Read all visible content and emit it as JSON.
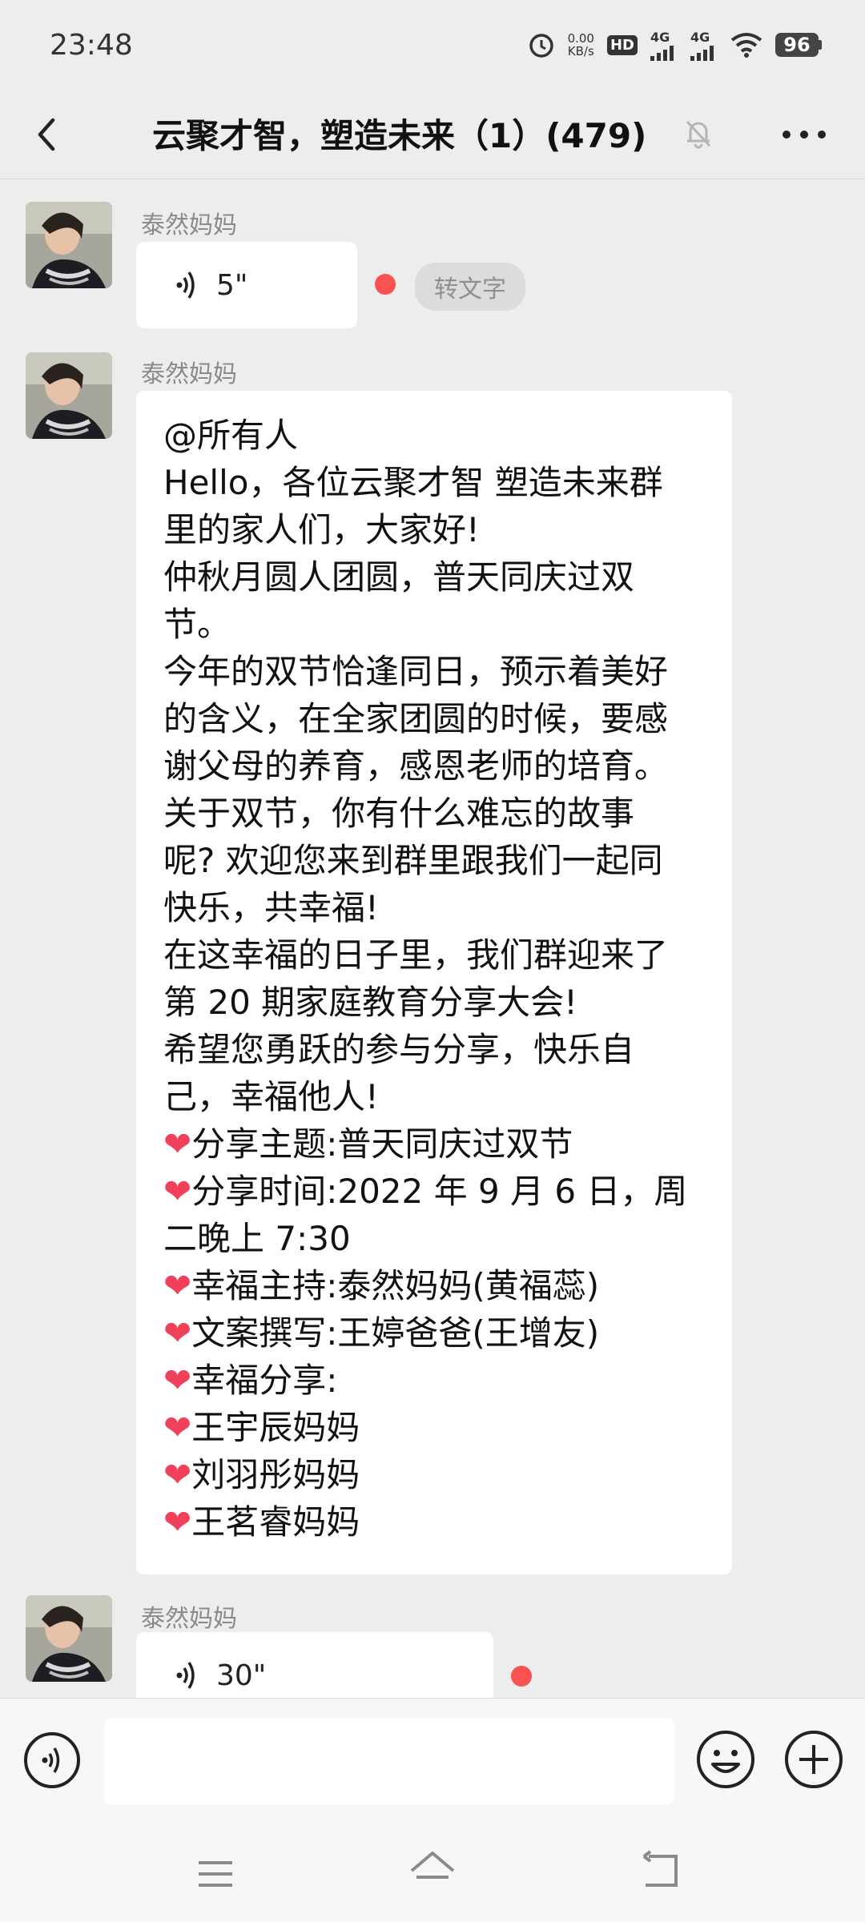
{
  "status_bar": {
    "time": "23:48",
    "net_speed_value": "0.00",
    "net_speed_unit": "KB/s",
    "hd_label": "HD",
    "sim1_label": "4G",
    "sim2_label": "4G",
    "battery": "96"
  },
  "header": {
    "title": "云聚才智，塑造未来（1）(479)"
  },
  "messages": [
    {
      "sender": "泰然妈妈",
      "type": "voice",
      "duration": "5\"",
      "to_text_label": "转文字"
    },
    {
      "sender": "泰然妈妈",
      "type": "text",
      "lines": [
        "@所有人",
        "Hello，各位云聚才智 塑造未来群",
        "里的家人们，大家好!",
        "仲秋月圆人团圆，普天同庆过双",
        "节。",
        "今年的双节恰逢同日，预示着美好",
        "的含义，在全家团圆的时候，要感",
        "谢父母的养育，感恩老师的培育。",
        "关于双节，你有什么难忘的故事",
        "呢? 欢迎您来到群里跟我们一起同",
        "快乐，共幸福!",
        "在这幸福的日子里，我们群迎来了",
        "第 20 期家庭教育分享大会!",
        "希望您勇跃的参与分享，快乐自",
        "己，幸福他人!",
        "❤分享主题:普天同庆过双节",
        "❤分享时间:2022 年 9 月 6 日，周",
        "二晚上 7:30",
        "❤幸福主持:泰然妈妈(黄福蕊)",
        "❤文案撰写:王婷爸爸(王增友)",
        "❤幸福分享:",
        "❤王宇辰妈妈",
        "❤刘羽彤妈妈",
        "❤王茗睿妈妈"
      ]
    },
    {
      "sender": "泰然妈妈",
      "type": "voice",
      "duration": "30\""
    }
  ],
  "input_bar": {
    "placeholder": ""
  },
  "icons": {
    "back": "chevron-left-icon",
    "mute": "bell-muted-icon",
    "more": "more-dots-icon",
    "voice": "voice-wave-icon",
    "emoji": "smiley-icon",
    "plus": "plus-circle-icon"
  },
  "colors": {
    "background": "#ededed",
    "bubble": "#ffffff",
    "unread_dot": "#fa5151",
    "heart": "#f0405a"
  }
}
